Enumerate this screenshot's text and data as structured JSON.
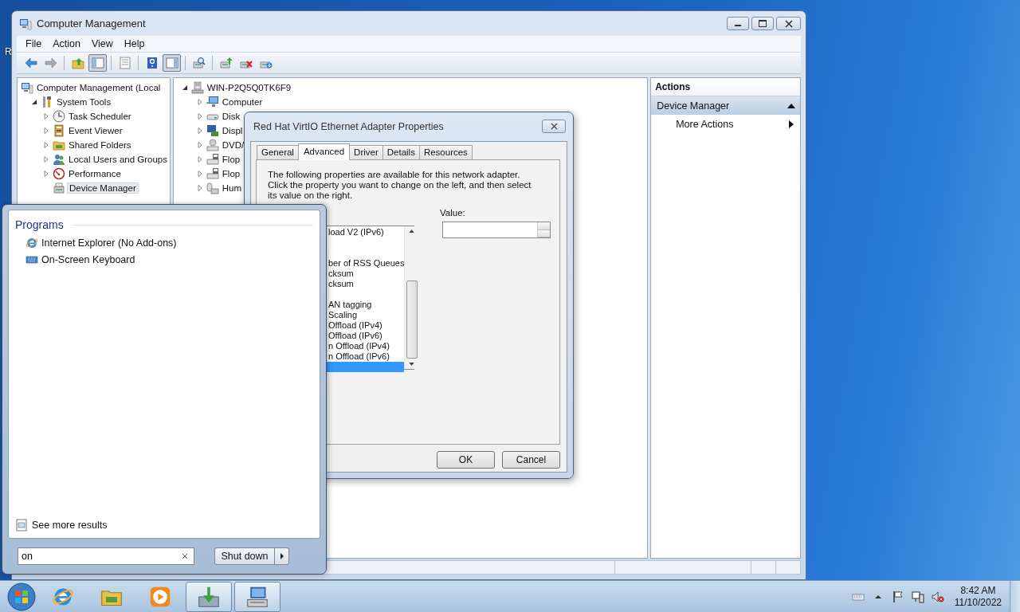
{
  "desktop": {
    "icon_label": "R"
  },
  "window": {
    "title": "Computer Management",
    "menu": [
      "File",
      "Action",
      "View",
      "Help"
    ],
    "toolbar": [
      {
        "kind": "back",
        "pressed": false
      },
      {
        "kind": "forward",
        "pressed": false
      },
      {
        "kind": "separator"
      },
      {
        "kind": "up",
        "pressed": false
      },
      {
        "kind": "tree",
        "pressed": true
      },
      {
        "kind": "separator"
      },
      {
        "kind": "props",
        "pressed": false
      },
      {
        "kind": "separator"
      },
      {
        "kind": "help",
        "pressed": false
      },
      {
        "kind": "action",
        "pressed": true
      },
      {
        "kind": "separator"
      },
      {
        "kind": "scan",
        "pressed": false
      },
      {
        "kind": "separator"
      },
      {
        "kind": "update",
        "pressed": false
      },
      {
        "kind": "uninstall",
        "pressed": false
      },
      {
        "kind": "install",
        "pressed": false
      }
    ],
    "left_tree": [
      {
        "label": "Computer Management (Local",
        "kind": "computer",
        "selected": false,
        "children": [
          {
            "label": "System Tools",
            "kind": "tools",
            "expanded": true,
            "selected": false,
            "children": [
              {
                "label": "Task Scheduler",
                "kind": "clock",
                "expanded": false,
                "selected": false
              },
              {
                "label": "Event Viewer",
                "kind": "log",
                "expanded": false,
                "selected": false
              },
              {
                "label": "Shared Folders",
                "kind": "folder",
                "expanded": false,
                "selected": false
              },
              {
                "label": "Local Users and Groups",
                "kind": "users",
                "expanded": false,
                "selected": false
              },
              {
                "label": "Performance",
                "kind": "perf",
                "expanded": false,
                "selected": false
              },
              {
                "label": "Device Manager",
                "kind": "device",
                "selected": true
              }
            ]
          }
        ]
      }
    ],
    "device_tree": [
      {
        "label": "WIN-P2Q5Q0TK6F9",
        "kind": "server",
        "expanded": true,
        "selected": false,
        "children": [
          {
            "label": "Computer",
            "kind": "monitor",
            "expanded": false,
            "selected": false
          },
          {
            "label": "Disk",
            "kind": "disk",
            "expanded": false,
            "selected": false
          },
          {
            "label": "Displ",
            "kind": "display",
            "expanded": false,
            "selected": false
          },
          {
            "label": "DVD/",
            "kind": "dvd",
            "expanded": false,
            "selected": false
          },
          {
            "label": "Flop",
            "kind": "floppy",
            "expanded": false,
            "selected": false
          },
          {
            "label": "Flop",
            "kind": "floppy",
            "expanded": false,
            "selected": false
          },
          {
            "label": "Hum",
            "kind": "hid",
            "expanded": false,
            "selected": false
          }
        ]
      }
    ],
    "actions": {
      "header": "Actions",
      "items": [
        {
          "label": "Device Manager",
          "kind": "section"
        },
        {
          "label": "More Actions",
          "kind": "submenu"
        }
      ]
    }
  },
  "dialog": {
    "title": "Red Hat VirtIO Ethernet Adapter Properties",
    "tabs": [
      {
        "label": "General",
        "selected": false
      },
      {
        "label": "Advanced",
        "selected": true
      },
      {
        "label": "Driver",
        "selected": false
      },
      {
        "label": "Details",
        "selected": false
      },
      {
        "label": "Resources",
        "selected": false
      }
    ],
    "description": "The following properties are available for this network adapter. Click the property you want to change on the left, and then select its value on the right.",
    "value_label": "Value:",
    "properties": [
      {
        "text": "load V2 (IPv6)",
        "selected": false
      },
      {
        "selected": false
      },
      {
        "selected": false
      },
      {
        "text": "ber of RSS Queues",
        "selected": false
      },
      {
        "text": "cksum",
        "selected": false
      },
      {
        "text": "cksum",
        "selected": false
      },
      {
        "selected": false
      },
      {
        "text": "AN tagging",
        "selected": false
      },
      {
        "text": "Scaling",
        "selected": false
      },
      {
        "text": "Offload (IPv4)",
        "selected": false
      },
      {
        "text": "Offload (IPv6)",
        "selected": false
      },
      {
        "text": "n Offload (IPv4)",
        "selected": false
      },
      {
        "text": "n Offload (IPv6)",
        "selected": false
      },
      {
        "selected": true
      }
    ],
    "buttons": [
      "OK",
      "Cancel"
    ]
  },
  "start_menu": {
    "section": "Programs",
    "programs": [
      {
        "label": "Internet Explorer (No Add-ons)",
        "kind": "ie"
      },
      {
        "label": "On-Screen Keyboard",
        "kind": "keyboard"
      }
    ],
    "more_results": "See more results",
    "search": {
      "value": "on"
    },
    "shutdown": "Shut down"
  },
  "taskbar": {
    "items": [
      {
        "kind": "ie",
        "running": false
      },
      {
        "kind": "folder",
        "running": false
      },
      {
        "kind": "media",
        "running": false
      },
      {
        "kind": "arrowbox",
        "running": true
      },
      {
        "kind": "mgmt",
        "running": true
      }
    ],
    "tray": [
      {
        "kind": "trkbd"
      },
      {
        "kind": "trup"
      },
      {
        "kind": "flag"
      },
      {
        "kind": "network"
      },
      {
        "kind": "speaker"
      }
    ],
    "clock": {
      "time": "8:42 AM",
      "date": "11/10/2022"
    }
  }
}
